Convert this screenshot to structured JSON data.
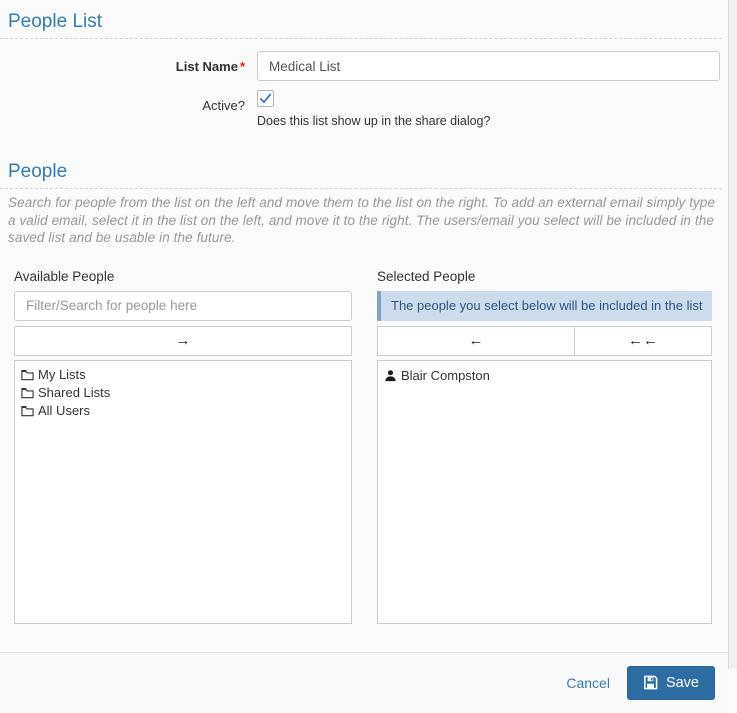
{
  "people_list_section": {
    "title": "People List",
    "list_name_label": "List Name",
    "required_marker": "*",
    "list_name_value": "Medical List",
    "active_label": "Active?",
    "active_checked": true,
    "active_help": "Does this list show up in the share dialog?"
  },
  "people_section": {
    "title": "People",
    "description": "Search for people from the list on the left and move them to the list on the right. To add an external email simply type a valid email, select it in the list on the left, and move it to the right. The users/email you select will be included in the saved list and be usable in the future.",
    "available": {
      "label": "Available People",
      "filter_placeholder": "Filter/Search for people here",
      "move_right_label": "→",
      "tree_items": [
        {
          "label": "My Lists"
        },
        {
          "label": "Shared Lists"
        },
        {
          "label": "All Users"
        }
      ]
    },
    "selected": {
      "label": "Selected People",
      "info_message": "The people you select below will be included in the list",
      "move_left_label": "←",
      "move_all_left_label": "←←",
      "people": [
        {
          "name": "Blair Compston"
        }
      ]
    }
  },
  "footer": {
    "cancel_label": "Cancel",
    "save_label": "Save"
  },
  "icons": {
    "folder": "folder-outline-icon",
    "person": "person-icon",
    "save": "floppy-disk-icon",
    "checkbox_check": "check-icon"
  },
  "colors": {
    "accent_blue": "#337ab7",
    "save_button_bg": "#2e6da4",
    "info_bar_bg": "#ccdcec",
    "info_bar_border": "#84a2c2",
    "info_bar_text": "#2b5480",
    "required_red": "#e01b1b",
    "check_blue": "#3a7cbf"
  }
}
